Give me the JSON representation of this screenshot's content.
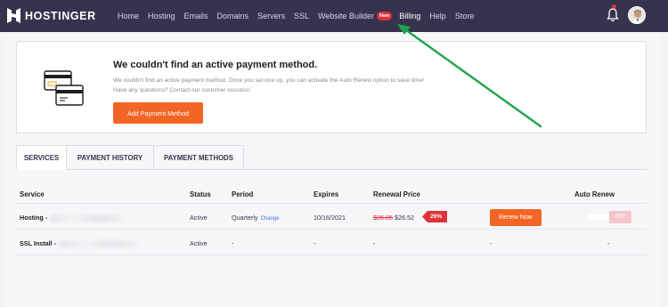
{
  "brand": {
    "name": "HOSTINGER"
  },
  "nav": {
    "items": [
      "Home",
      "Hosting",
      "Emails",
      "Domains",
      "Servers",
      "SSL",
      "Website Builder",
      "Billing",
      "Help",
      "Store"
    ],
    "new_badge": "New"
  },
  "alert": {
    "title": "We couldn't find an active payment method.",
    "line1": "We couldn't find an active payment method. Once you set one up, you can activate the Auto Renew option to save time!",
    "line2": "Have any questions? Contact our customer success!",
    "button": "Add Payment Method"
  },
  "tabs": [
    "SERVICES",
    "PAYMENT HISTORY",
    "PAYMENT METHODS"
  ],
  "table": {
    "headers": [
      "Service",
      "Status",
      "Period",
      "Expires",
      "Renewal Price",
      "Auto Renew"
    ],
    "rows": [
      {
        "service": "Hosting -",
        "status": "Active",
        "period": "Quarterly",
        "change": "Change",
        "expires": "10/16/2021",
        "old_price": "$35.85",
        "price": "$26.52",
        "discount": "26%",
        "action": "Renew Now",
        "auto_renew": "OFF"
      },
      {
        "service": "SSL Install -",
        "status": "Active",
        "period": "-",
        "expires": "-",
        "price": "-",
        "action": "-",
        "auto_renew": "-"
      }
    ]
  },
  "colors": {
    "topbar": "#36344d",
    "accent": "#f36524",
    "badge": "#e0323c",
    "arrow": "#1fa34a",
    "link": "#3b6fd7"
  }
}
